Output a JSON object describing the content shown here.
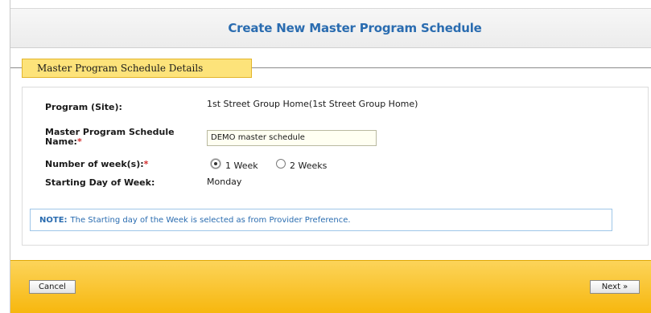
{
  "header": {
    "title": "Create New Master Program Schedule"
  },
  "section": {
    "title": "Master Program Schedule Details"
  },
  "form": {
    "program_label": "Program (Site):",
    "program_value": "1st Street Group Home(1st Street Group Home)",
    "name_label": "Master Program Schedule Name:",
    "name_value": "DEMO master schedule",
    "weeks_label": "Number of week(s):",
    "weeks_options": [
      {
        "label": "1 Week",
        "selected": true
      },
      {
        "label": "2 Weeks",
        "selected": false
      }
    ],
    "start_day_label": "Starting Day of Week:",
    "start_day_value": "Monday",
    "required_marker": "*"
  },
  "note": {
    "prefix": "NOTE:",
    "text": "The Starting day of the Week is selected as from Provider Preference."
  },
  "footer": {
    "cancel_label": "Cancel",
    "next_label": "Next »"
  },
  "colors": {
    "title": "#2a6cb0",
    "section_tab": "#fde37a",
    "footer": "#f7b70e",
    "required": "#d32f2f"
  }
}
